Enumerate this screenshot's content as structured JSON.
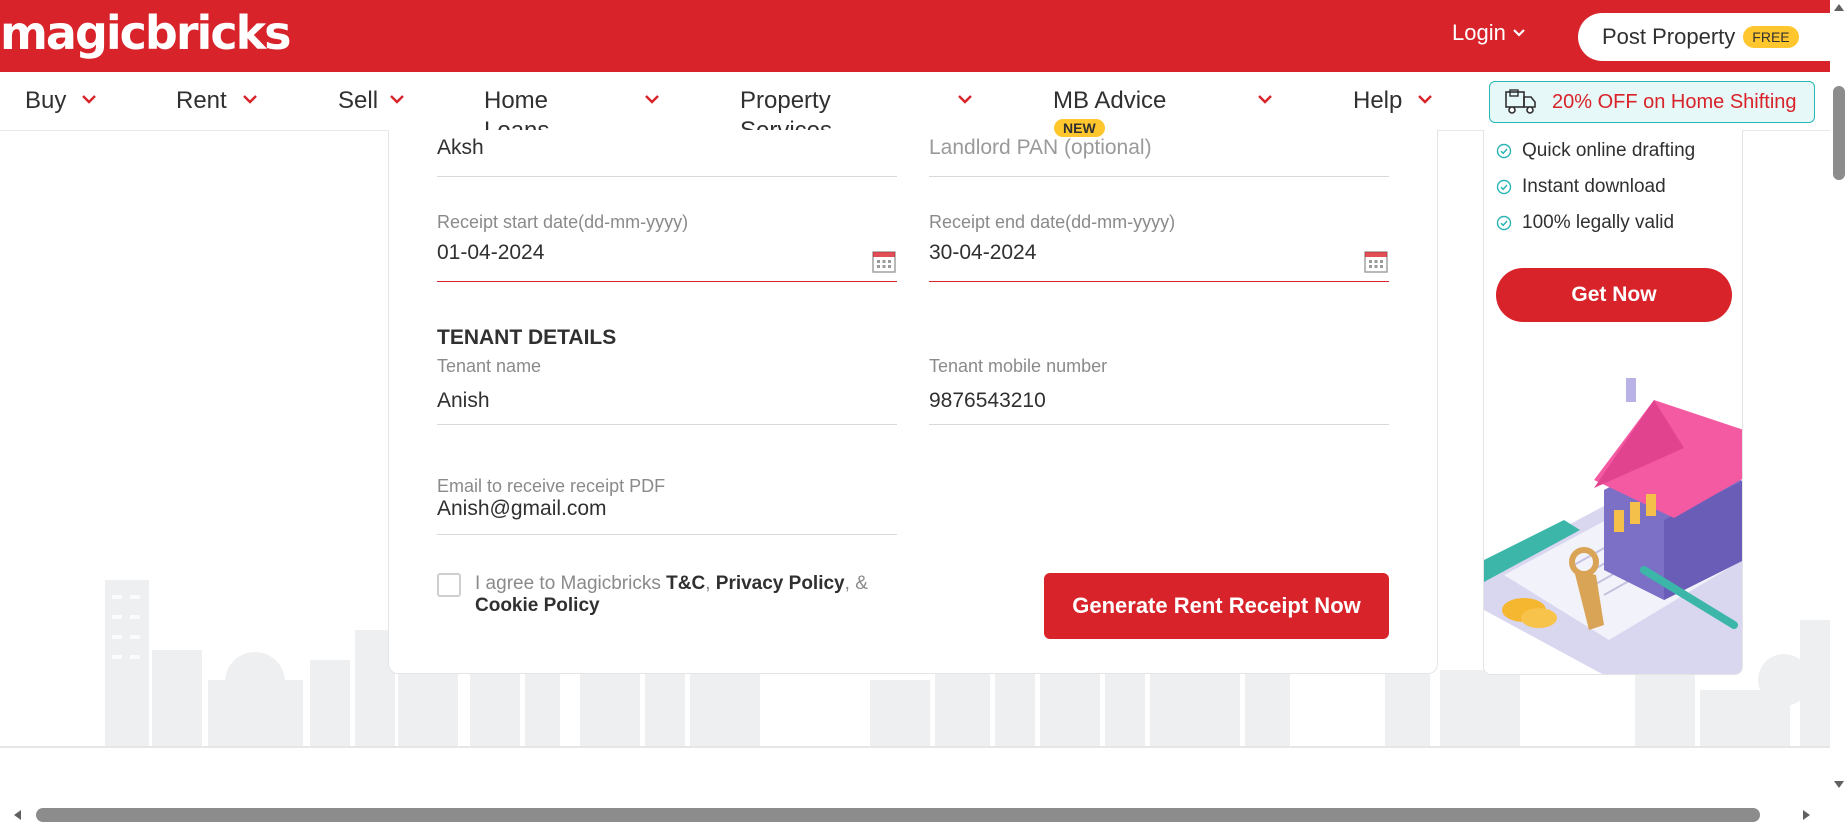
{
  "header": {
    "logo": "magicbricks",
    "login_label": "Login",
    "post_property_label": "Post Property",
    "free_badge": "FREE"
  },
  "nav": {
    "items": [
      {
        "label": "Buy"
      },
      {
        "label": "Rent"
      },
      {
        "label": "Sell"
      },
      {
        "label": "Home Loans"
      },
      {
        "label": "Property Services"
      },
      {
        "label": "MB Advice"
      },
      {
        "label": "Help"
      }
    ],
    "new_badge": "NEW",
    "promo_label": "20% OFF on Home Shifting"
  },
  "form": {
    "landlord_name_value": "Aksh",
    "landlord_pan_placeholder": "Landlord PAN (optional)",
    "start_date_label": "Receipt start date(dd-mm-yyyy)",
    "start_date_value": "01-04-2024",
    "end_date_label": "Receipt end date(dd-mm-yyyy)",
    "end_date_value": "30-04-2024",
    "tenant_section_title": "TENANT DETAILS",
    "tenant_name_label": "Tenant name",
    "tenant_name_value": "Anish",
    "tenant_mobile_label": "Tenant mobile number",
    "tenant_mobile_value": "9876543210",
    "email_label": "Email to receive receipt PDF",
    "email_value": "Anish@gmail.com",
    "agree_prefix": "I agree to Magicbricks",
    "tc_link": "T&C",
    "comma": ",",
    "privacy_link": "Privacy Policy",
    "and_text": ", &",
    "cookie_link": "Cookie Policy",
    "generate_button": "Generate Rent Receipt Now"
  },
  "promo": {
    "features": [
      "Quick online drafting",
      "Instant download",
      "100% legally valid"
    ],
    "get_now_button": "Get Now"
  },
  "colors": {
    "brand_red": "#d8232a",
    "badge_yellow": "#ffc62d",
    "teal": "#2bb5b5"
  }
}
